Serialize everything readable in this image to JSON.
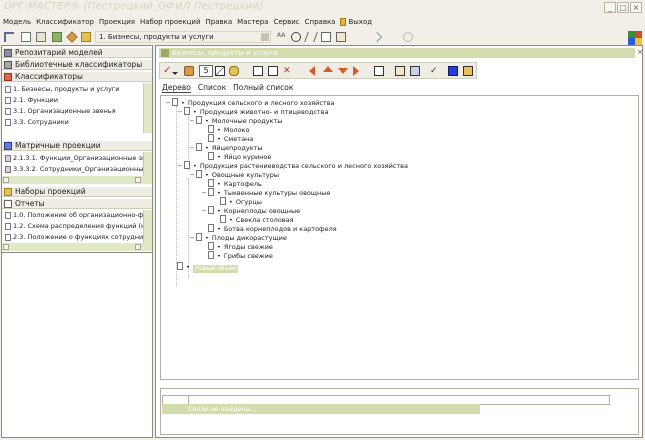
{
  "window": {
    "title": "ОРГ-МАСТЕР® [Пестрецкий_ОФИЛ Пестрецкий]",
    "controls": [
      "_",
      "□",
      "×"
    ]
  },
  "menu": {
    "items": [
      "Модель",
      "Классификатор",
      "Проекция",
      "Набор проекций",
      "Правка",
      "Мастера",
      "Сервис",
      "Справка"
    ],
    "exit_label": "Выход"
  },
  "toolbar": {
    "projection_value": "1. Бизнесы, продукты и услуги",
    "font_label": "AA"
  },
  "left_panel": {
    "repository_label": "Репозитарий моделей",
    "library_label": "Библиотечные классификаторы",
    "classifiers_label": "Классификаторы",
    "classifiers": [
      "1. Бизнесы, продукты и услуги",
      "2.1. Функции",
      "3.1. Организационные звенья",
      "3.3. Сотрудники"
    ],
    "matrix_label": "Матричные проекции",
    "matrix": [
      "2.1.3.1. Функции_Организационные звенья",
      "3.3.3.2. Сотрудники_Организационные звенья"
    ],
    "sets_label": "Наборы проекций",
    "reports_label": "Отчеты",
    "reports": [
      "1.0. Положение об организационно-функ",
      "1.2. Схема распределения функций (кра",
      "2.3. Положение о функциях сотрудника"
    ]
  },
  "right_panel": {
    "header": "Бизнесы, продукты и услуги",
    "close_label": "×",
    "level_value": "5",
    "tabs": [
      "Дерево",
      "Список",
      "Полный список"
    ],
    "tree": [
      {
        "label": "Продукция сельского и лесного хозяйства"
      },
      {
        "label": "Продукция животно- и птицеводства"
      },
      {
        "label": "Молочные продукты"
      },
      {
        "label": "Молоко"
      },
      {
        "label": "Сметана"
      },
      {
        "label": "Яйцепродукты"
      },
      {
        "label": "Яйцо куриное"
      },
      {
        "label": "Продукция растениеводства сельского и лесного хозяйства"
      },
      {
        "label": "Овощные культуры"
      },
      {
        "label": "Картофель"
      },
      {
        "label": "Тыквенные культуры овощные"
      },
      {
        "label": "Огурцы"
      },
      {
        "label": "Корнеплоды овощные"
      },
      {
        "label": "Свекла столовая"
      },
      {
        "label": "Ботва корнеплодов и картофеля"
      },
      {
        "label": "Плоды дикорастущие"
      },
      {
        "label": "Ягоды свежие"
      },
      {
        "label": "Грибы свежие"
      }
    ],
    "new_node_label": "Новый объект",
    "bottom_row_text": "Связи не найдены..."
  },
  "colors": {
    "accent_green": "#d2dcad",
    "background": "#f1efe7"
  }
}
